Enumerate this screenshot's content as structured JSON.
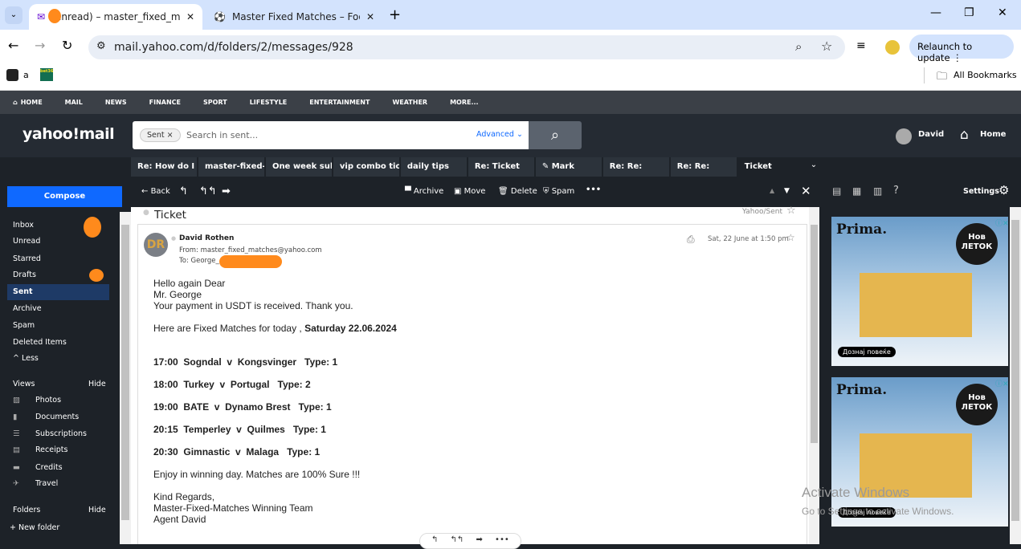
{
  "browser": {
    "tabs": [
      {
        "label": "(unread) – master_fixed_matc",
        "active": true
      },
      {
        "label": "Master Fixed Matches – Footbal",
        "active": false
      }
    ],
    "url": "mail.yahoo.com/d/folders/2/messages/928",
    "relaunch": "Relaunch to update",
    "bookmarks": [
      {
        "label": "a"
      },
      {
        "label": "bet365"
      }
    ],
    "all_bookmarks": "All Bookmarks"
  },
  "nav": [
    "HOME",
    "MAIL",
    "NEWS",
    "FINANCE",
    "SPORT",
    "LIFESTYLE",
    "ENTERTAINMENT",
    "WEATHER",
    "MORE..."
  ],
  "header": {
    "logo": "yahoo!mail",
    "search_chip": "Sent",
    "search_placeholder": "Search in sent...",
    "advanced": "Advanced",
    "user": "David",
    "home": "Home"
  },
  "mail_tabs": [
    "Re: How do I ge",
    "master-fixed-m",
    "One week subs",
    "vip combo ticke",
    "daily tips",
    "Re: Ticket",
    "Mark",
    "Re: Re:",
    "Re: Re:",
    "Ticket"
  ],
  "sidebar": {
    "compose": "Compose",
    "folders": [
      "Inbox",
      "Unread",
      "Starred",
      "Drafts",
      "Sent",
      "Archive",
      "Spam",
      "Deleted Items",
      "^ Less"
    ],
    "views_label": "Views",
    "hide": "Hide",
    "views": [
      "Photos",
      "Documents",
      "Subscriptions",
      "Receipts",
      "Credits",
      "Travel"
    ],
    "folders_label": "Folders",
    "new_folder": "+ New folder"
  },
  "toolbar": {
    "back": "Back",
    "archive": "Archive",
    "move": "Move",
    "delete": "Delete",
    "spam": "Spam"
  },
  "right": {
    "settings": "Settings",
    "ad_brand": "Prima.",
    "ad_badge": "Нов ЛЕТОК",
    "ad_cta": "Дознај повеќе"
  },
  "message": {
    "subject": "Ticket",
    "folder": "Yahoo/Sent",
    "sender": "David Rothen",
    "avatar": "DR",
    "from": "From: master_fixed_matches@yahoo.com",
    "to": "To: George_           87@gmail.com",
    "date": "Sat, 22 June at 1:50 pm",
    "lines": [
      "Hello again Dear",
      "Mr. George",
      "Your payment in USDT is received. Thank you."
    ],
    "intro": "Here are Fixed Matches for today ,",
    "date_bold": "Saturday 22.06.2024",
    "matches": [
      "17:00  Sogndal  v  Kongsvinger   Type: 1",
      "18:00  Turkey  v  Portugal   Type: 2",
      "19:00  BATE  v  Dynamo Brest   Type: 1",
      "20:15  Temperley  v  Quilmes   Type: 1",
      "20:30  Gimnastic  v  Malaga   Type: 1"
    ],
    "enjoy": "Enjoy in winning day. Matches are 100% Sure !!!",
    "sign": [
      "Kind Regards,",
      "Master-Fixed-Matches Winning Team",
      "Agent David"
    ]
  },
  "watermark": {
    "title": "Activate Windows",
    "sub": "Go to Settings to activate Windows."
  }
}
